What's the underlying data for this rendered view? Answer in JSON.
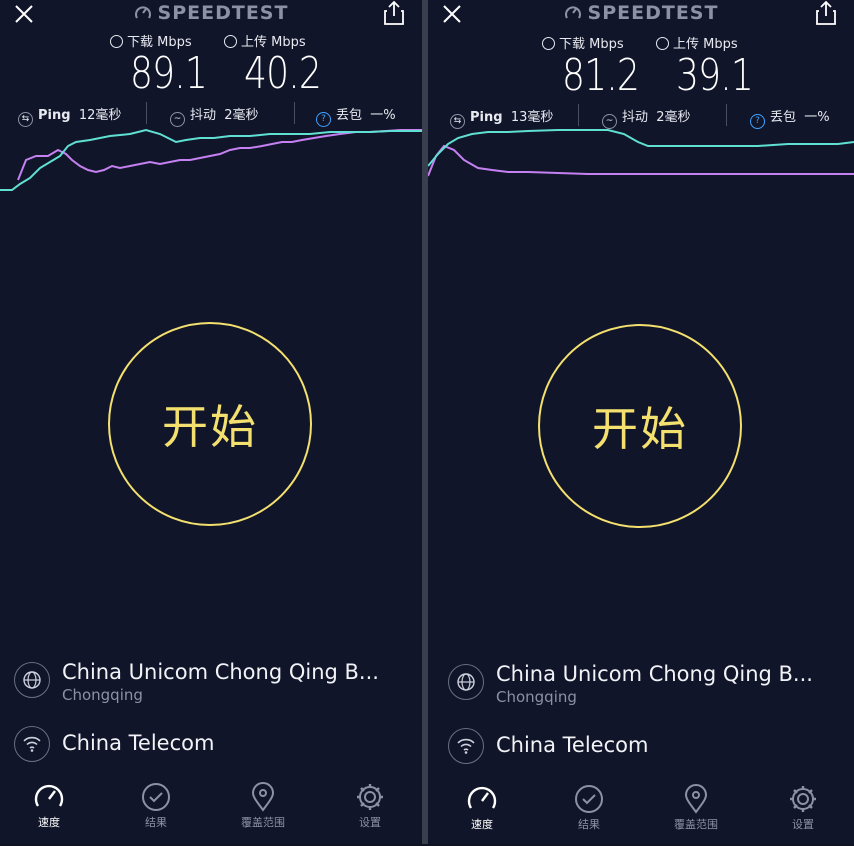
{
  "left": {
    "brand": "SPEEDTEST",
    "download": {
      "label": "下载 Mbps",
      "value": "89.1"
    },
    "upload": {
      "label": "上传 Mbps",
      "value": "40.2"
    },
    "ping": {
      "label": "Ping",
      "value": "12毫秒"
    },
    "jitter": {
      "label": "抖动",
      "value": "2毫秒"
    },
    "loss": {
      "label": "丢包",
      "value": "一%"
    },
    "start_label": "开始",
    "server": {
      "name": "China Unicom Chong Qing B...",
      "location": "Chongqing"
    },
    "isp": "China Telecom",
    "nav": [
      "速度",
      "结果",
      "覆盖范围",
      "设置"
    ]
  },
  "right": {
    "brand": "SPEEDTEST",
    "download": {
      "label": "下载 Mbps",
      "value": "81.2"
    },
    "upload": {
      "label": "上传 Mbps",
      "value": "39.1"
    },
    "ping": {
      "label": "Ping",
      "value": "13毫秒"
    },
    "jitter": {
      "label": "抖动",
      "value": "2毫秒"
    },
    "loss": {
      "label": "丢包",
      "value": "一%"
    },
    "start_label": "开始",
    "server": {
      "name": "China Unicom Chong Qing B...",
      "location": "Chongqing"
    },
    "isp": "China Telecom",
    "nav": [
      "速度",
      "结果",
      "覆盖范围",
      "设置"
    ]
  },
  "colors": {
    "background": "#11152a",
    "download": "#5fe0d3",
    "upload": "#c580f1",
    "accent": "#f3e06e"
  },
  "icons": [
    "close-icon",
    "share-icon",
    "speedtest-gauge-icon",
    "globe-icon",
    "wifi-icon",
    "speed-gauge-icon",
    "check-circle-icon",
    "location-pin-icon",
    "gear-icon"
  ]
}
